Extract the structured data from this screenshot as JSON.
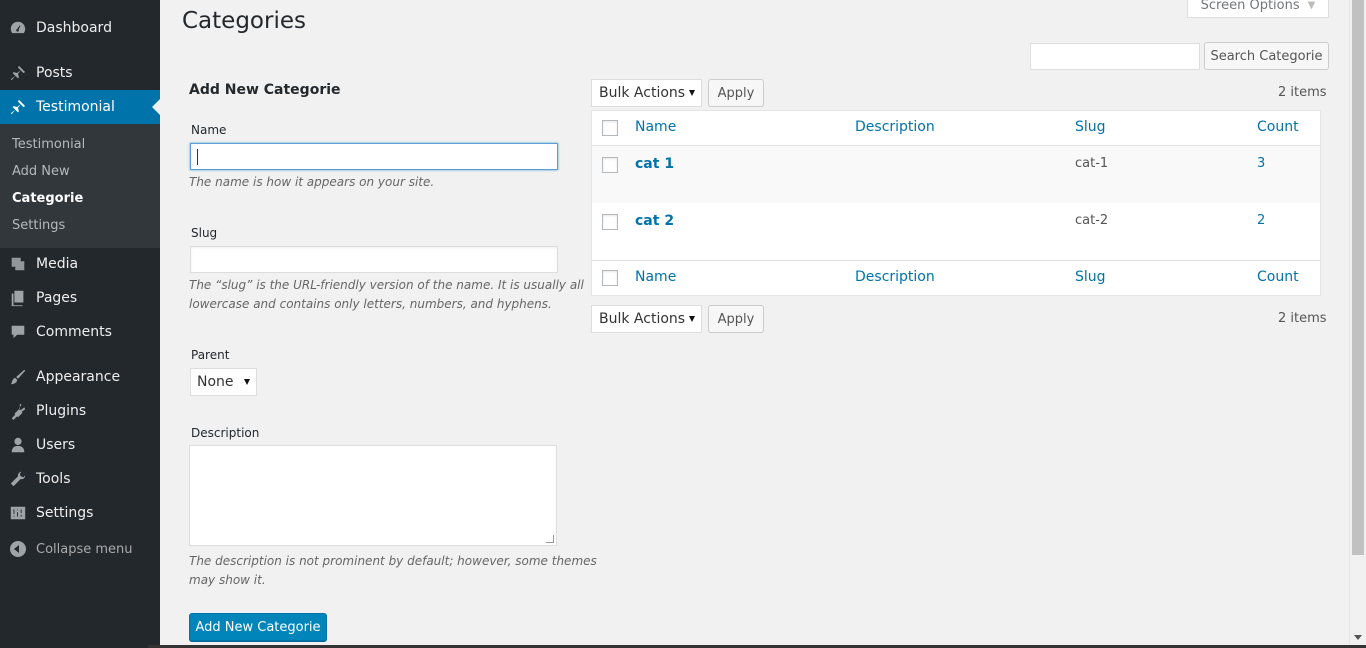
{
  "sidebar": {
    "dashboard": "Dashboard",
    "posts": "Posts",
    "testimonial": "Testimonial",
    "submenu": [
      "Testimonial",
      "Add New",
      "Categorie",
      "Settings"
    ],
    "media": "Media",
    "pages": "Pages",
    "comments": "Comments",
    "appearance": "Appearance",
    "plugins": "Plugins",
    "users": "Users",
    "tools": "Tools",
    "settings": "Settings",
    "collapse": "Collapse menu"
  },
  "header": {
    "title": "Categories",
    "screen_options": "Screen Options",
    "search_button": "Search Categorie",
    "search_value": ""
  },
  "form": {
    "heading": "Add New Categorie",
    "name_label": "Name",
    "name_value": "",
    "name_hint": "The name is how it appears on your site.",
    "slug_label": "Slug",
    "slug_hint_1": "The “slug” is the URL-friendly version of the name. It is usually all",
    "slug_hint_2": "lowercase and contains only letters, numbers, and hyphens.",
    "parent_label": "Parent",
    "parent_value": "None",
    "description_label": "Description",
    "description_hint_1": "The description is not prominent by default; however, some themes",
    "description_hint_2": "may show it.",
    "submit": "Add New Categorie"
  },
  "table": {
    "bulk_actions": "Bulk Actions",
    "apply": "Apply",
    "items_count": "2 items",
    "columns": [
      "Name",
      "Description",
      "Slug",
      "Count"
    ],
    "rows": [
      {
        "name": "cat 1",
        "description": "",
        "slug": "cat-1",
        "count": "3"
      },
      {
        "name": "cat 2",
        "description": "",
        "slug": "cat-2",
        "count": "2"
      }
    ]
  },
  "colors": {
    "sidebar_bg": "#23282d",
    "accent": "#0073aa",
    "primary_button": "#0085ba"
  }
}
